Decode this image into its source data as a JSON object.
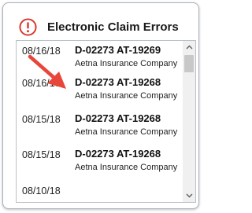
{
  "header": {
    "title": "Electronic Claim Errors",
    "icon": "alert-circle-icon",
    "icon_color": "#d93025"
  },
  "claims": [
    {
      "date": "08/16/18",
      "code": "D-02273 AT-19269",
      "company": "Aetna Insurance Company"
    },
    {
      "date": "08/16/18",
      "code": "D-02273 AT-19268",
      "company": "Aetna Insurance Company"
    },
    {
      "date": "08/15/18",
      "code": "D-02273 AT-19268",
      "company": "Aetna Insurance Company"
    },
    {
      "date": "08/15/18",
      "code": "D-02273 AT-19268",
      "company": "Aetna Insurance Company"
    },
    {
      "date": "08/10/18",
      "code": "",
      "company": ""
    }
  ],
  "annotation": {
    "type": "arrow",
    "color": "#e8463a",
    "points_to": "claim row 2"
  }
}
